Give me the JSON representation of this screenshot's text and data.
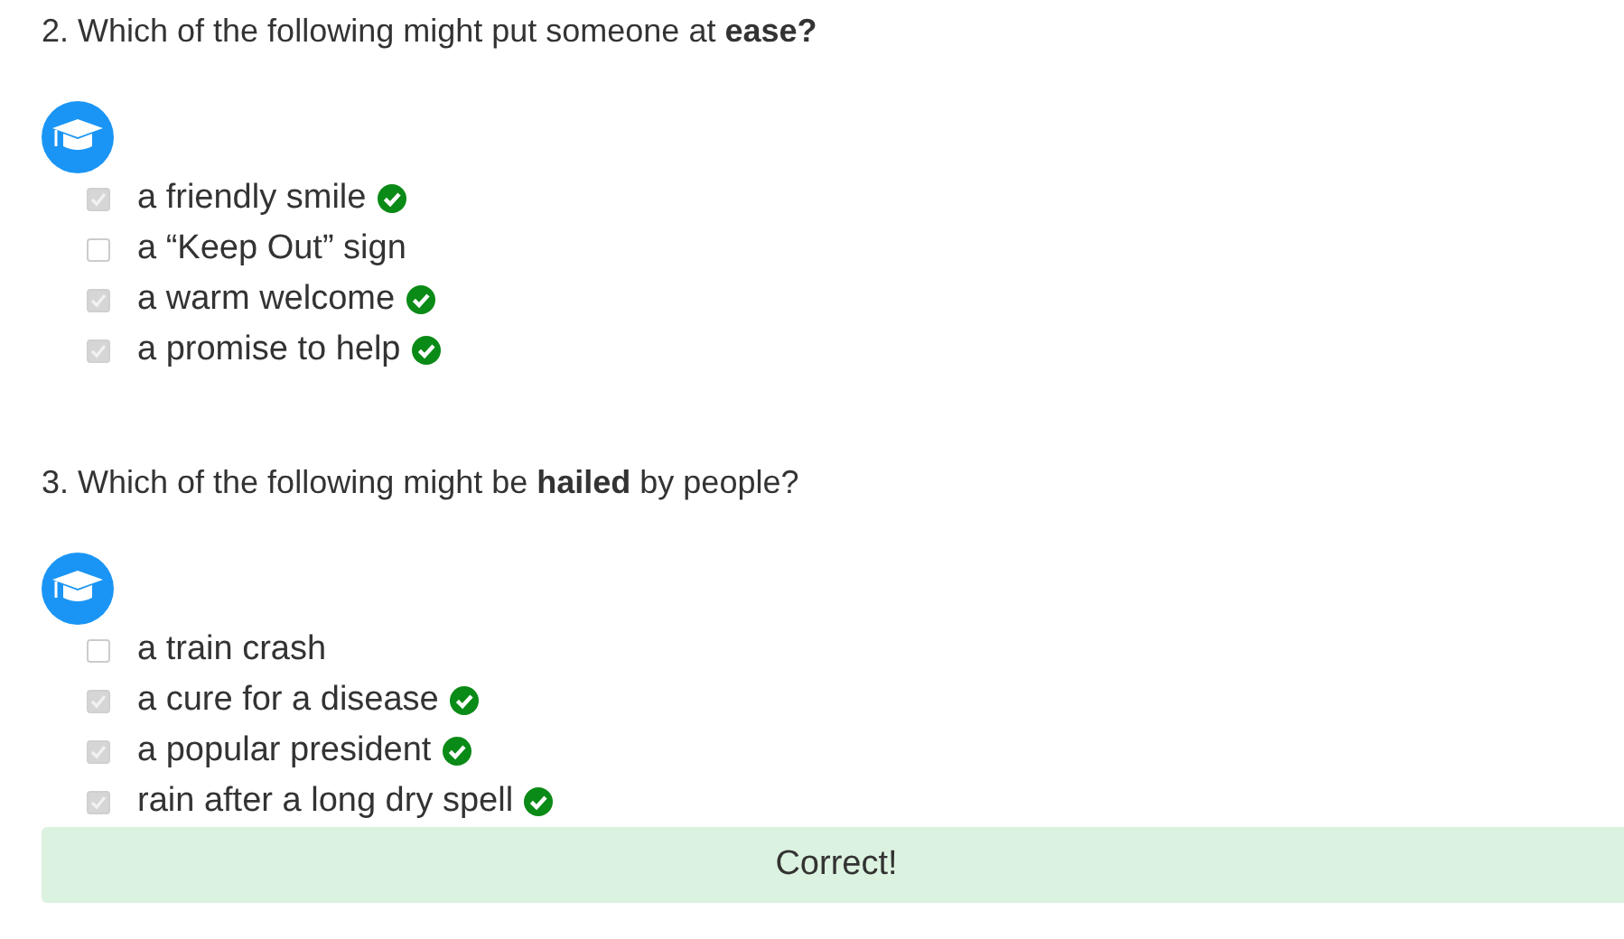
{
  "questions": [
    {
      "prompt": "2. Which of the following might put someone at **ease?**",
      "options": [
        {
          "label": "a friendly smile",
          "checked": true,
          "correct": true
        },
        {
          "label": "a “Keep Out” sign",
          "checked": false,
          "correct": false
        },
        {
          "label": "a warm welcome",
          "checked": true,
          "correct": true
        },
        {
          "label": "a promise to help",
          "checked": true,
          "correct": true
        }
      ]
    },
    {
      "prompt": "3. Which of the following might be **hailed** by people?",
      "options": [
        {
          "label": "a train crash",
          "checked": false,
          "correct": false
        },
        {
          "label": "a cure for a disease",
          "checked": true,
          "correct": true
        },
        {
          "label": "a popular president",
          "checked": true,
          "correct": true
        },
        {
          "label": "rain after a long dry spell",
          "checked": true,
          "correct": true
        }
      ]
    }
  ],
  "feedback": {
    "text": "Correct!"
  }
}
